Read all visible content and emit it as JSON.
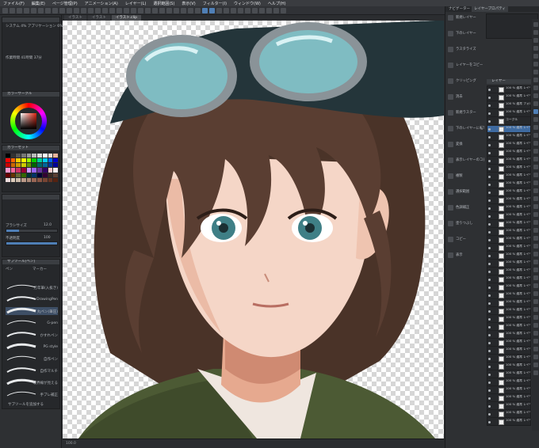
{
  "menu": [
    "ファイル(F)",
    "編集(E)",
    "ページ管理(P)",
    "アニメーション(A)",
    "レイヤー(L)",
    "選択範囲(S)",
    "表示(V)",
    "フィルター(I)",
    "ウィンドウ(W)",
    "ヘルプ(H)"
  ],
  "canvas_tabs": [
    "イラスト",
    "イラスト",
    "イラスト.clip"
  ],
  "left": {
    "history_lines": [
      "システム 4% アプリケーション 6%",
      "作業時間 41時間 37分"
    ],
    "color_wheel_title": "カラーサークル",
    "color_set_title": "カラーセット",
    "tool_property": {
      "brush_size_label": "ブラシサイズ",
      "brush_size_value": "12.0",
      "opacity_label": "不透明度",
      "opacity_value": "100",
      "opacity_fraction": 1.0,
      "brush_size_fraction": 0.25
    },
    "subtools_title": "サブツール[ペン]",
    "subtool_tabs": [
      "ペン",
      "マーカー"
    ],
    "brushes": [
      "万年筆(入抜き)",
      "DrawingPen",
      "丸ペン(筆圧)",
      "G-pen",
      "かすれペン",
      "PG style",
      "自作ペン",
      "自作マルチ",
      "境界線が見える",
      "手ブレ補正"
    ],
    "add_subtool": "サブツールを追加する"
  },
  "right": {
    "tabs": [
      "ナビゲーター",
      "レイヤープロパティ"
    ],
    "commands": [
      "新規レイヤー",
      "下のレイヤー",
      "ラスタライズ",
      "レイヤーをコピー",
      "クリッピング",
      "消去",
      "新規ラスター",
      "下のレイヤーに転写",
      "変換",
      "表示レイヤーのコピー",
      "複製",
      "選択範囲",
      "色調補正",
      "塗りつぶし",
      "コピー",
      "表示"
    ],
    "layer_panel_title": "レイヤー",
    "layers": [
      "100 % 通常 レイヤー 46",
      "100 % 通常 レイヤー 45",
      "100 % 通常 フォルダー",
      "100 % 通常 レイヤー 44",
      "ゴーグル",
      "100 % 通常 レイヤー 43",
      "100 % 通常 レイヤー 42",
      "100 % 通常 レイヤー 41",
      "100 % 通常 レイヤー 40",
      "100 % 通常 レイヤー 39",
      "100 % 通常 レイヤー 38",
      "100 % 通常 レイヤー 37",
      "100 % 通常 レイヤー 36",
      "100 % 通常 レイヤー 35",
      "100 % 通常 レイヤー 34",
      "100 % 通常 レイヤー 33",
      "100 % 通常 レイヤー 32",
      "100 % 通常 レイヤー 31",
      "100 % 通常 レイヤー 30",
      "100 % 通常 レイヤー 29",
      "100 % 通常 レイヤー 28",
      "100 % 通常 レイヤー 27",
      "100 % 通常 レイヤー 26",
      "100 % 通常 レイヤー 25",
      "100 % 通常 レイヤー 24",
      "100 % 通常 レイヤー 23",
      "100 % 通常 レイヤー 22",
      "100 % 通常 レイヤー 21",
      "100 % 通常 レイヤー 20",
      "100 % 通常 レイヤー 19",
      "100 % 通常 レイヤー 18",
      "100 % 通常 レイヤー 17",
      "100 % 通常 レイヤー 16",
      "100 % 通常 レイヤー 15",
      "100 % 通常 レイヤー 14",
      "100 % 通常 レイヤー 13",
      "100 % 通常 レイヤー 12",
      "100 % 通常 レイヤー 11",
      "100 % 通常 レイヤー 10",
      "100 % 通常 レイヤー 9",
      "100 % 通常 レイヤー 8",
      "100 % 通常 レイヤー 7",
      "100 % 通常 レイヤー 6"
    ],
    "selected_layer_index": 5
  },
  "status": {
    "zoom": "100.0"
  },
  "colors": {
    "accent": "#4f7fb6",
    "panel": "#2e3033",
    "selected_layer": "#3e6aa0"
  }
}
